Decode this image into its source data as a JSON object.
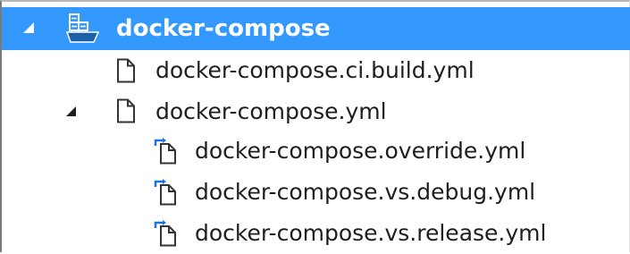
{
  "tree": {
    "root": {
      "label": "docker-compose",
      "icon": "docker-compose-project-icon",
      "expanded": true,
      "selected": true
    },
    "items": [
      {
        "label": "docker-compose.ci.build.yml",
        "icon": "file-icon"
      },
      {
        "label": "docker-compose.yml",
        "icon": "file-icon",
        "expanded": true
      },
      {
        "label": "docker-compose.override.yml",
        "icon": "nested-file-icon"
      },
      {
        "label": "docker-compose.vs.debug.yml",
        "icon": "nested-file-icon"
      },
      {
        "label": "docker-compose.vs.release.yml",
        "icon": "nested-file-icon"
      }
    ]
  },
  "colors": {
    "selection": "#3399ff",
    "selection_text": "#ffffff",
    "text": "#1e1e1e",
    "nested_arrow": "#1a73e8"
  }
}
